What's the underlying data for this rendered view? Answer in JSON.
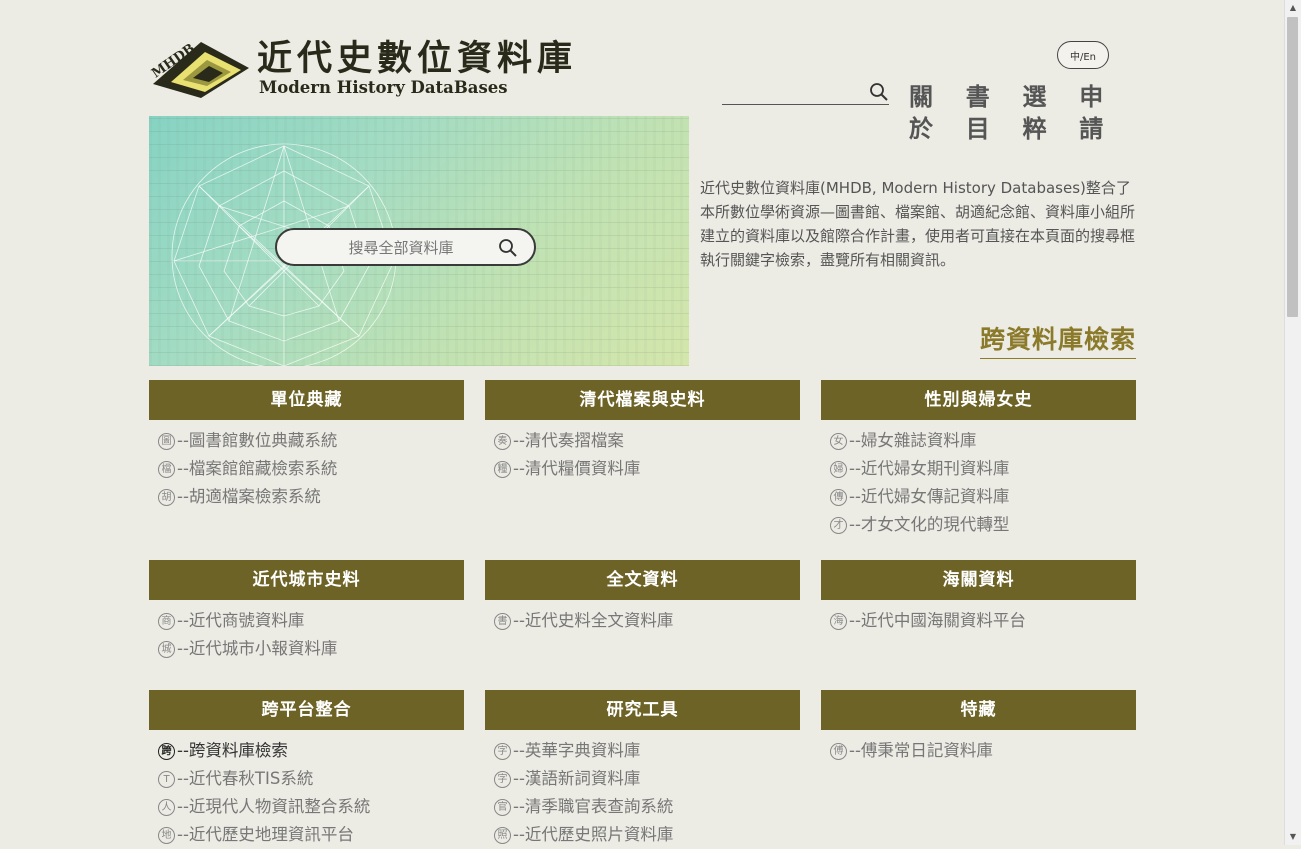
{
  "header": {
    "logo_cn": "近代史數位資料庫",
    "logo_en": "Modern History DataBases",
    "logo_mark_text": "MHDB",
    "lang_toggle": "中/En",
    "search_placeholder": "",
    "nav": [
      "關於",
      "書目",
      "選粹",
      "申請"
    ]
  },
  "hero": {
    "search_placeholder": "搜尋全部資料庫"
  },
  "intro": "近代史數位資料庫(MHDB, Modern History Databases)整合了本所數位學術資源—圖書館、檔案館、胡適紀念館、資料庫小組所建立的資料庫以及館際合作計畫，使用者可直接在本頁面的搜尋框執行關鍵字檢索，盡覽所有相關資訊。",
  "section_title": "跨資料庫檢索",
  "colors": {
    "accent": "#6e6326",
    "title": "#8a7a2a",
    "background": "#ecebe4"
  },
  "categories": [
    {
      "title": "單位典藏",
      "items": [
        {
          "seal": "圖",
          "label": "--圖書館數位典藏系統"
        },
        {
          "seal": "檔",
          "label": "--檔案館館藏檢索系統"
        },
        {
          "seal": "胡",
          "label": "--胡適檔案檢索系統"
        }
      ]
    },
    {
      "title": "清代檔案與史料",
      "items": [
        {
          "seal": "奏",
          "label": "--清代奏摺檔案"
        },
        {
          "seal": "糧",
          "label": "--清代糧價資料庫"
        }
      ]
    },
    {
      "title": "性別與婦女史",
      "items": [
        {
          "seal": "女",
          "label": "--婦女雜誌資料庫"
        },
        {
          "seal": "婦",
          "label": "--近代婦女期刊資料庫"
        },
        {
          "seal": "傳",
          "label": "--近代婦女傳記資料庫"
        },
        {
          "seal": "才",
          "label": "--才女文化的現代轉型"
        }
      ]
    },
    {
      "title": "近代城市史料",
      "items": [
        {
          "seal": "商",
          "label": "--近代商號資料庫"
        },
        {
          "seal": "城",
          "label": "--近代城市小報資料庫"
        }
      ]
    },
    {
      "title": "全文資料",
      "items": [
        {
          "seal": "書",
          "label": "--近代史料全文資料庫"
        }
      ]
    },
    {
      "title": "海關資料",
      "items": [
        {
          "seal": "海",
          "label": "--近代中國海關資料平台"
        }
      ]
    },
    {
      "title": "跨平台整合",
      "items": [
        {
          "seal": "跨",
          "label": "--跨資料庫檢索",
          "active": true
        },
        {
          "seal": "T",
          "label": "--近代春秋TIS系統"
        },
        {
          "seal": "人",
          "label": "--近現代人物資訊整合系統"
        },
        {
          "seal": "地",
          "label": "--近代歷史地理資訊平台"
        }
      ]
    },
    {
      "title": "研究工具",
      "items": [
        {
          "seal": "字",
          "label": "--英華字典資料庫"
        },
        {
          "seal": "字",
          "label": "--漢語新詞資料庫"
        },
        {
          "seal": "官",
          "label": "--清季職官表查詢系統"
        },
        {
          "seal": "照",
          "label": "--近代歷史照片資料庫"
        }
      ]
    },
    {
      "title": "特藏",
      "items": [
        {
          "seal": "傅",
          "label": "--傅秉常日記資料庫"
        }
      ]
    }
  ]
}
